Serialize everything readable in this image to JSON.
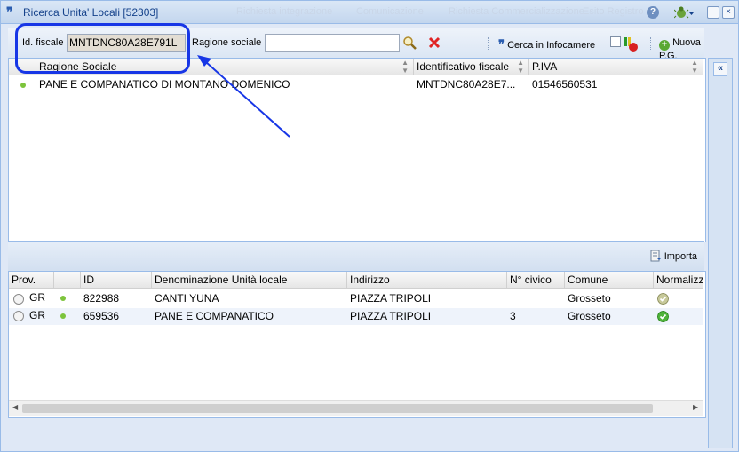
{
  "window": {
    "title": "Ricerca Unita' Locali [52303]",
    "ghost_tabs": [
      "Richiesta integrazione",
      "Comunicazione",
      "Richiesta Commercializzazione",
      "Esito Registro"
    ]
  },
  "toolbar": {
    "id_fiscale_label": "Id. fiscale",
    "id_fiscale_value": "MNTDNC80A28E791L",
    "ragione_sociale_label": "Ragione sociale",
    "ragione_sociale_value": "",
    "cerca_infocamere_label": "Cerca in Infocamere",
    "nuova_pg_label": "Nuova P.G."
  },
  "top_grid": {
    "columns": [
      "Ragione Sociale",
      "Identificativo fiscale",
      "P.IVA"
    ],
    "rows": [
      {
        "ragione_sociale": "PANE E COMPANATICO DI MONTANO DOMENICO",
        "id_fiscale": "MNTDNC80A28E7...",
        "piva": "01546560531"
      }
    ]
  },
  "middle_bar": {
    "importa_label": "Importa"
  },
  "bottom_grid": {
    "columns": [
      "Prov.",
      "",
      "ID",
      "Denominazione Unità locale",
      "Indirizzo",
      "N° civico",
      "Comune",
      "Normalizz"
    ],
    "rows": [
      {
        "prov": "GR",
        "id": "822988",
        "denominazione": "CANTI YUNA",
        "indirizzo": "PIAZZA TRIPOLI",
        "civico": "",
        "comune": "Grosseto"
      },
      {
        "prov": "GR",
        "id": "659536",
        "denominazione": "PANE E COMPANATICO",
        "indirizzo": "PIAZZA TRIPOLI",
        "civico": "3",
        "comune": "Grosseto"
      }
    ]
  },
  "colors": {
    "accent": "#15428b",
    "callout": "#1736e6",
    "status_green": "#7dc43c"
  }
}
